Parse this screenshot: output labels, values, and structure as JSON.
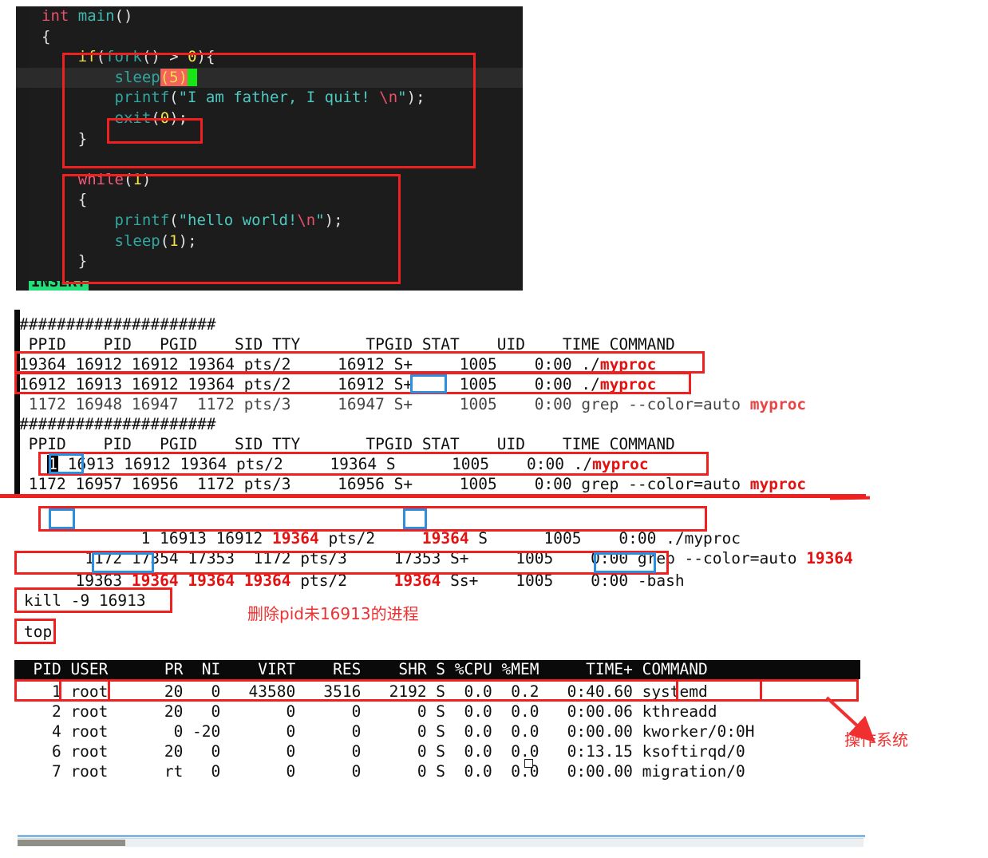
{
  "editor": {
    "name": "vim-code-editor",
    "language": "c",
    "lines": [
      {
        "id": "l1",
        "text": "int main()"
      },
      {
        "id": "l2",
        "text": "{"
      },
      {
        "id": "l3",
        "text": "    if(fork() > 0){"
      },
      {
        "id": "l4",
        "text": "        sleep(5)"
      },
      {
        "id": "l5",
        "text": "        printf(\"I am father, I quit! \\n\");"
      },
      {
        "id": "l6",
        "text": "        exit(0);"
      },
      {
        "id": "l7",
        "text": "    }"
      },
      {
        "id": "l8",
        "text": ""
      },
      {
        "id": "l9",
        "text": "    while(1)"
      },
      {
        "id": "l10",
        "text": "    {"
      },
      {
        "id": "l11",
        "text": "        printf(\"hello world!\\n\");"
      },
      {
        "id": "l12",
        "text": "        sleep(1);"
      },
      {
        "id": "l13",
        "text": "    }"
      }
    ],
    "status_mode": "INSERT",
    "cursor_line": 4
  },
  "terminal": {
    "separator": "#####################",
    "ps_header": " PPID    PID   PGID    SID TTY       TPGID STAT    UID    TIME COMMAND",
    "block1": {
      "rows": [
        {
          "pre": "19364 16912 16912 19364 pts/2     16912 S+     1005    0:00 ./",
          "cmd": "myproc",
          "cmd_red": true
        },
        {
          "pre": "16912 16913 16912 19364 pts/2     16912 S+     1005    0:00 ./",
          "cmd": "myproc",
          "cmd_red": true
        },
        {
          "pre": " 1172 16948 16947  1172 pts/3     16947 S+     1005    0:00 grep --color=auto ",
          "cmd": "myproc",
          "cmd_red": true
        }
      ]
    },
    "block2": {
      "rows": [
        {
          "pre_inv": "1",
          "pre": " 16913 16912 19364 pts/2     19364 S      1005    0:00 ./",
          "cmd": "myproc",
          "cmd_red": true
        },
        {
          "pre": " 1172 16957 16956  1172 pts/3     16956 S+     1005    0:00 grep --color=auto ",
          "cmd": "myproc",
          "cmd_red": true
        }
      ]
    },
    "block3": {
      "rows": [
        {
          "segs": [
            {
              "t": "    1 16913 16912 ",
              "c": "k"
            },
            {
              "t": "19364",
              "c": "r"
            },
            {
              "t": " pts/2     ",
              "c": "k"
            },
            {
              "t": "19364",
              "c": "r"
            },
            {
              "t": " S      1005    0:00 ./myproc",
              "c": "k"
            }
          ]
        },
        {
          "segs": [
            {
              "t": " 1172 17354 17353  1172 pts/3     17353 S+     1005    0:00 grep --color=auto ",
              "c": "k"
            },
            {
              "t": "19364",
              "c": "r"
            }
          ]
        },
        {
          "segs": [
            {
              "t": "19363 ",
              "c": "k"
            },
            {
              "t": "19364",
              "c": "r"
            },
            {
              "t": " ",
              "c": "k"
            },
            {
              "t": "19364",
              "c": "r"
            },
            {
              "t": " ",
              "c": "k"
            },
            {
              "t": "19364",
              "c": "r"
            },
            {
              "t": " pts/2     ",
              "c": "k"
            },
            {
              "t": "19364",
              "c": "r"
            },
            {
              "t": " Ss+    1005    0:00 -bash",
              "c": "k"
            }
          ]
        }
      ]
    },
    "kill_cmd": "kill -9 16913",
    "top_cmd": "top"
  },
  "annotations": {
    "kill_note": "删除pid未16913的进程",
    "os_note": "操作系统"
  },
  "top": {
    "header": "  PID USER      PR  NI    VIRT    RES    SHR S %CPU %MEM     TIME+ COMMAND",
    "columns": [
      "PID",
      "USER",
      "PR",
      "NI",
      "VIRT",
      "RES",
      "SHR",
      "S",
      "%CPU",
      "%MEM",
      "TIME+",
      "COMMAND"
    ],
    "rows": [
      {
        "text": "    1 root      20   0   43580   3516   2192 S  0.0  0.2   0:40.60 systemd"
      },
      {
        "text": "    2 root      20   0       0      0      0 S  0.0  0.0   0:00.06 kthreadd"
      },
      {
        "text": "    4 root       0 -20       0      0      0 S  0.0  0.0   0:00.00 kworker/0:0H"
      },
      {
        "text": "    6 root      20   0       0      0      0 S  0.0  0.0   0:13.15 ksoftirqd/0"
      },
      {
        "text": "    7 root      rt   0       0      0      0 S  0.0  0.0   0:00.00 migration/0"
      }
    ]
  },
  "colors": {
    "annotation_red": "#ef2020",
    "annotation_blue": "#2a8fe0",
    "terminal_bg": "#0a0a0a",
    "editor_bg": "#1c1c1c",
    "grep_red": "#e51010",
    "status_green": "#24e07a"
  }
}
